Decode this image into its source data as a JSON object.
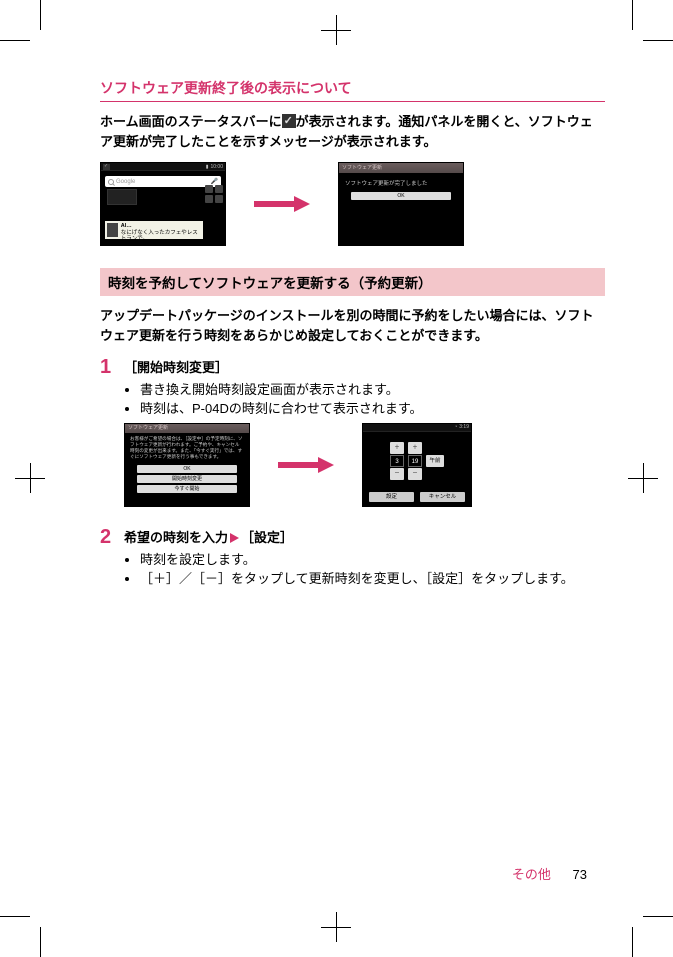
{
  "heading1": "ソフトウェア更新終了後の表示について",
  "para1_a": "ホーム画面のステータスバーに",
  "para1_b": "が表示されます。通知パネルを開くと、ソフトウェア更新が完了したことを示すメッセージが表示されます。",
  "figA": {
    "left": {
      "status_time": "10:00",
      "search_hint": "Google",
      "banner_title": "AI…",
      "banner_text": "なにげなく入ったカフェやレストランで。"
    },
    "right": {
      "title": "ソフトウェア更新",
      "message": "ソフトウェア更新が完了しました",
      "ok": "OK"
    }
  },
  "heading2": "時刻を予約してソフトウェアを更新する（予約更新）",
  "para2": "アップデートパッケージのインストールを別の時間に予約をしたい場合には、ソフトウェア更新を行う時刻をあらかじめ設定しておくことができます。",
  "step1": {
    "num": "1",
    "title": "［開始時刻変更］",
    "bullets": [
      "書き換え開始時刻設定画面が表示されます。",
      "時刻は、P-04Dの時刻に合わせて表示されます。"
    ]
  },
  "figB": {
    "left": {
      "title": "ソフトウェア更新",
      "body": "お客様がご希望の場合は、［設定中］の予定時刻に、ソフトウェア更新が行われます。ご予約や、キャンセル時刻の変更が出来ます。また、「今すぐ実行」では、すぐにソフトウェア更新を行う事もできます。",
      "btn_ok": "OK",
      "btn_change": "開始時刻変更",
      "btn_now": "今すぐ開始"
    },
    "right": {
      "status_clock": "3:19",
      "hour": "3",
      "minute": "19",
      "ampm": "午前",
      "plus": "＋",
      "minus": "－",
      "btn_set": "設定",
      "btn_cancel": "キャンセル"
    }
  },
  "step2": {
    "num": "2",
    "title_a": "希望の時刻を入力",
    "title_b": "［設定］",
    "bullets": [
      "時刻を設定します。",
      "［＋］／［－］をタップして更新時刻を変更し、［設定］をタップします。"
    ]
  },
  "footer": {
    "section": "その他",
    "page": "73"
  }
}
